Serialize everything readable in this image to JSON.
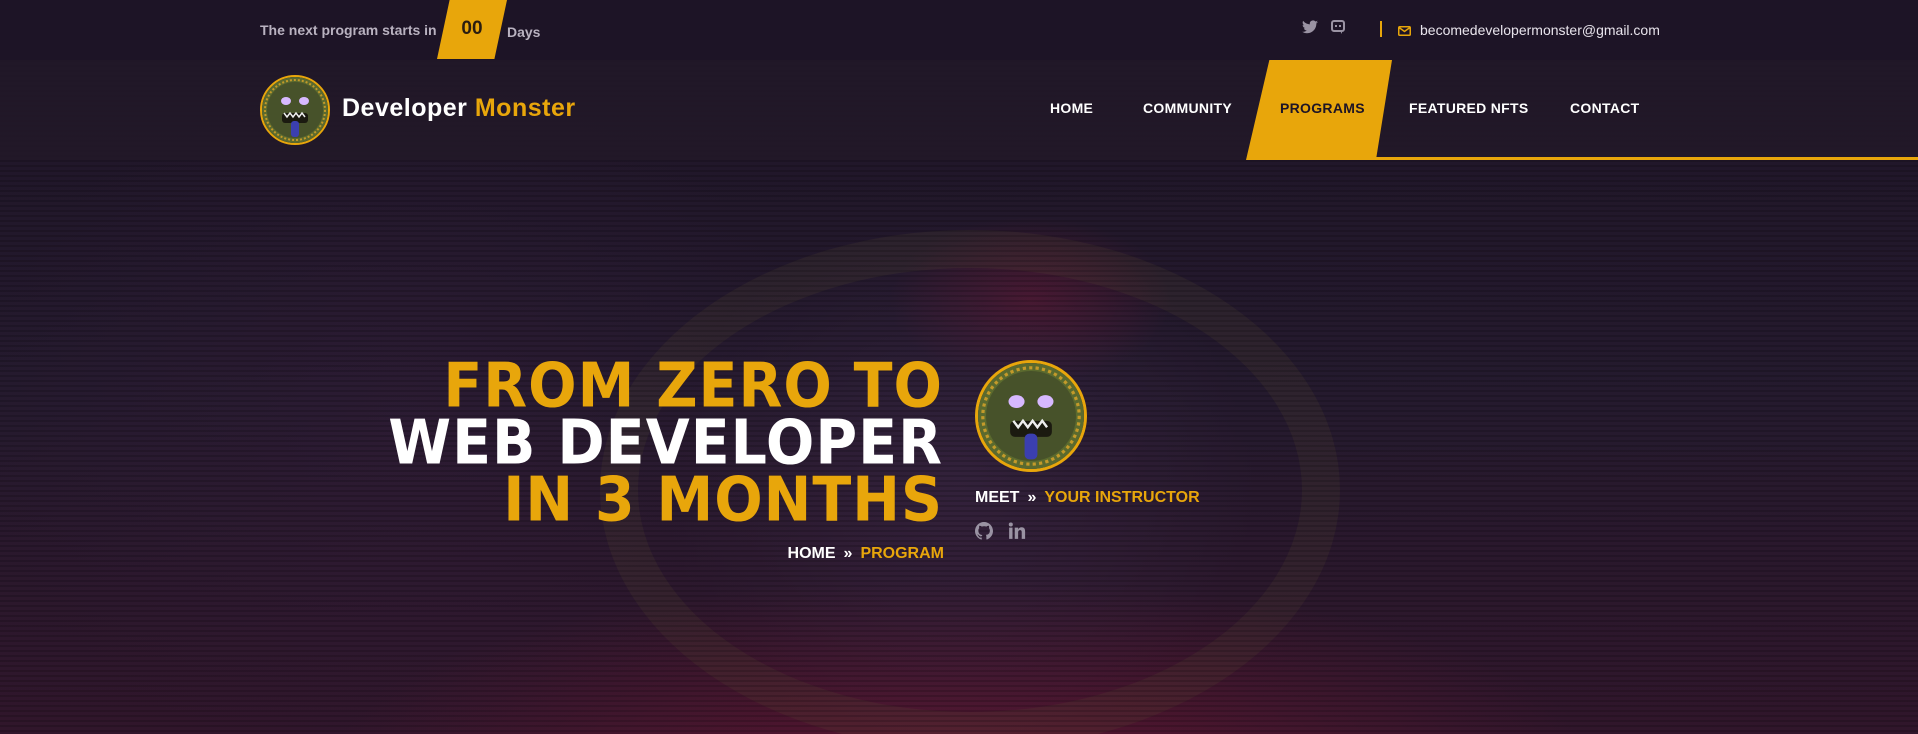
{
  "topbar": {
    "countdown_label": "The next program starts in",
    "countdown_value": "00",
    "countdown_unit": "Days",
    "social": [
      "twitter-icon",
      "discord-icon"
    ],
    "email": "becomedevelopermonster@gmail.com"
  },
  "brand": {
    "word1": "Developer",
    "word2": "Monster"
  },
  "nav": {
    "items": [
      {
        "label": "HOME"
      },
      {
        "label": "COMMUNITY"
      },
      {
        "label": "PROGRAMS",
        "active": true
      },
      {
        "label": "FEATURED NFTS"
      },
      {
        "label": "CONTACT"
      }
    ]
  },
  "hero": {
    "line1": "FROM ZERO TO",
    "line2": "WEB DEVELOPER",
    "line3": "IN 3 MONTHS",
    "breadcrumb": {
      "home": "HOME",
      "separator": "»",
      "current": "PROGRAM"
    },
    "instructor": {
      "meet": "MEET",
      "separator": "»",
      "label": "YOUR INSTRUCTOR"
    },
    "instructor_social": [
      "github-icon",
      "linkedin-icon"
    ]
  },
  "colors": {
    "accent": "#e8a60b",
    "background": "#1c1425"
  }
}
